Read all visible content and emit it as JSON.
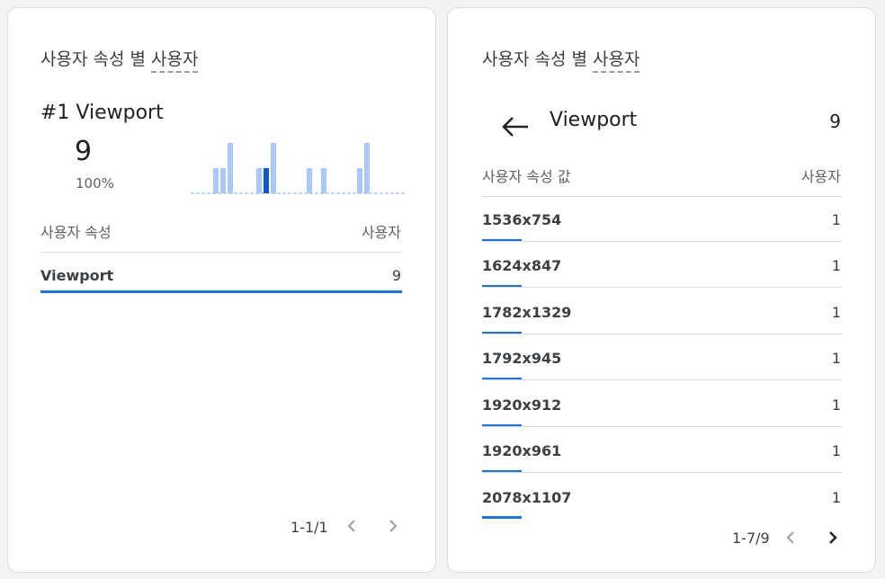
{
  "left_card": {
    "title_prefix": "사용자 속성 별 ",
    "title_metric": "사용자",
    "rank_title": "#1 Viewport",
    "value": "9",
    "percent": "100%",
    "sparkline": [
      0,
      0,
      0,
      2,
      2,
      4,
      0,
      0,
      0,
      2,
      2,
      4,
      0,
      0,
      0,
      0,
      2,
      0,
      2,
      0,
      0,
      0,
      0,
      2,
      4,
      0,
      0,
      0,
      0
    ],
    "sparkline_selected_index": 10,
    "col_dimension": "사용자 속성",
    "col_metric": "사용자",
    "rows": [
      {
        "label": "Viewport",
        "value": "9",
        "share": 1.0
      }
    ],
    "pager_text": "1-1/1"
  },
  "right_card": {
    "title_prefix": "사용자 속성 별 ",
    "title_metric": "사용자",
    "back_icon": "arrow-left-icon",
    "drill_title": "Viewport",
    "drill_count": "9",
    "col_dimension": "사용자 속성 값",
    "col_metric": "사용자",
    "rows": [
      {
        "label": "1536x754",
        "value": "1",
        "share": 0.111
      },
      {
        "label": "1624x847",
        "value": "1",
        "share": 0.111
      },
      {
        "label": "1782x1329",
        "value": "1",
        "share": 0.111
      },
      {
        "label": "1792x945",
        "value": "1",
        "share": 0.111
      },
      {
        "label": "1920x912",
        "value": "1",
        "share": 0.111
      },
      {
        "label": "1920x961",
        "value": "1",
        "share": 0.111
      },
      {
        "label": "2078x1107",
        "value": "1",
        "share": 0.111
      }
    ],
    "pager_text": "1-7/9"
  },
  "colors": {
    "accent": "#1a73e8",
    "spark_light": "#a8c7fa",
    "spark_dark": "#0b57d0"
  }
}
